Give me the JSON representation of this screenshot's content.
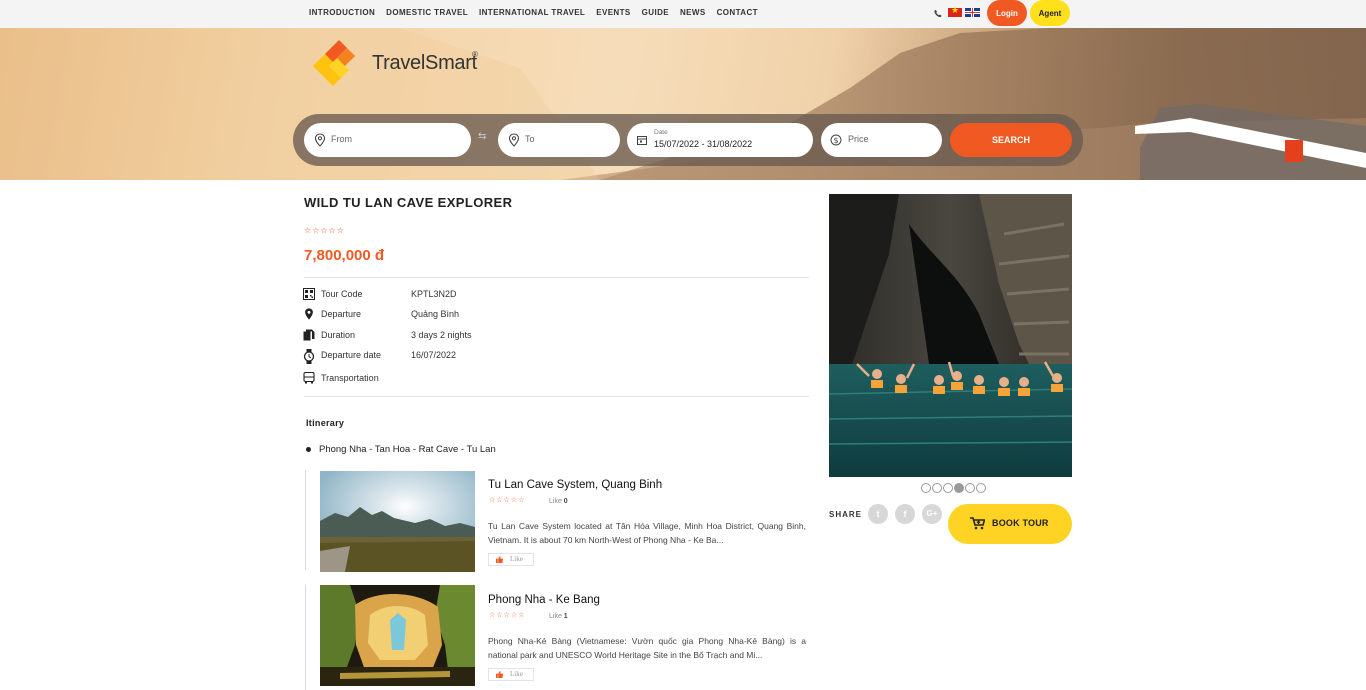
{
  "nav": {
    "items": [
      "INTRODUCTION",
      "DOMESTIC TRAVEL",
      "INTERNATIONAL TRAVEL",
      "EVENTS",
      "GUIDE",
      "NEWS",
      "CONTACT"
    ],
    "login_label": "Login",
    "agent_label": "Agent"
  },
  "brand": {
    "name": "TravelSmart",
    "reg": "®"
  },
  "search": {
    "from_placeholder": "From",
    "to_placeholder": "To",
    "date_label": "Date",
    "date_value": "15/07/2022 - 31/08/2022",
    "price_placeholder": "Price",
    "search_label": "SEARCH"
  },
  "tour": {
    "title": "WILD TU LAN CAVE EXPLORER",
    "stars": "☆☆☆☆☆",
    "price": "7,800,000 đ",
    "info": [
      {
        "label": "Tour Code",
        "value": "KPTL3N2D",
        "icon": "qr-code-icon"
      },
      {
        "label": "Departure",
        "value": "Quảng Bình",
        "icon": "location-pin-icon"
      },
      {
        "label": "Duration",
        "value": "3 days 2 nights",
        "icon": "document-copy-icon"
      },
      {
        "label": "Departure date",
        "value": "16/07/2022",
        "icon": "watch-icon"
      },
      {
        "label": "Transportation",
        "value": "",
        "icon": "bus-icon"
      }
    ]
  },
  "itinerary": {
    "title": "Itinerary",
    "route": "Phong Nha - Tan Hoa - Rat Cave - Tu Lan",
    "places": [
      {
        "title": "Tu Lan Cave System, Quang Binh",
        "stars": "☆☆☆☆☆",
        "like_prefix": "Like",
        "like_count": "0",
        "desc": "Tu Lan Cave System located at Tân Hóa Village, Minh Hoa District, Quang Binh, Vietnam. It is about 70 km North-West of Phong Nha - Ke Ba...",
        "like_button": "Like"
      },
      {
        "title": "Phong Nha - Ke Bang",
        "stars": "☆☆☆☆☆",
        "like_prefix": "Like",
        "like_count": "1",
        "desc": "Phong Nha-Kẻ Bàng (Vietnamese: Vườn quốc gia Phong Nha-Kẻ Bàng) is a national park and UNESCO World Heritage Site in the Bố Trạch and Mi...",
        "like_button": "Like"
      }
    ]
  },
  "gallery": {
    "slide_count": 6,
    "active_index": 3
  },
  "share": {
    "label": "SHARE",
    "buttons": [
      {
        "name": "twitter",
        "glyph": "t"
      },
      {
        "name": "facebook",
        "glyph": "f"
      },
      {
        "name": "google-plus",
        "glyph": "G+"
      }
    ]
  },
  "book": {
    "label": "BOOK TOUR"
  },
  "colors": {
    "accent": "#f05a22",
    "yellow": "#ffd324"
  }
}
